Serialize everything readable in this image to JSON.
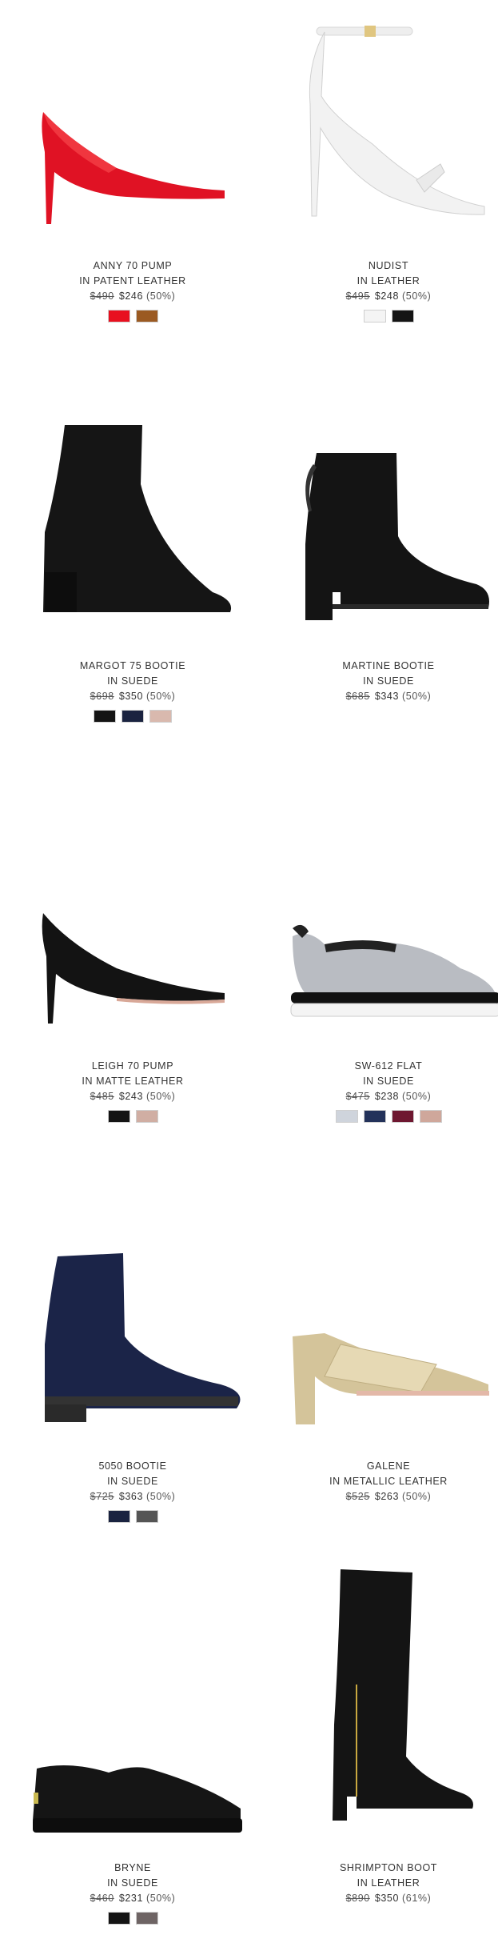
{
  "products": [
    {
      "name": "ANNY 70 PUMP",
      "material": "IN PATENT LEATHER",
      "orig": "$490",
      "sale": "$246",
      "disc": "(50%)",
      "swatches": [
        "#e8101f",
        "#9b5a22"
      ],
      "icon": "red-pump-shoe-icon"
    },
    {
      "name": "NUDIST",
      "material": "IN LEATHER",
      "orig": "$495",
      "sale": "$248",
      "disc": "(50%)",
      "swatches": [
        "#f4f4f4",
        "#141414"
      ],
      "icon": "white-strappy-sandal-icon"
    },
    {
      "name": "MARGOT 75 BOOTIE",
      "material": "IN SUEDE",
      "orig": "$698",
      "sale": "$350",
      "disc": "(50%)",
      "swatches": [
        "#141414",
        "#1a2340",
        "#d9b9ae"
      ],
      "icon": "black-sock-bootie-icon"
    },
    {
      "name": "MARTINE BOOTIE",
      "material": "IN SUEDE",
      "orig": "$685",
      "sale": "$343",
      "disc": "(50%)",
      "swatches": [],
      "icon": "black-ankle-bootie-icon"
    },
    {
      "name": "LEIGH 70 PUMP",
      "material": "IN MATTE LEATHER",
      "orig": "$485",
      "sale": "$243",
      "disc": "(50%)",
      "swatches": [
        "#141414",
        "#d0aea3"
      ],
      "icon": "black-pump-shoe-icon"
    },
    {
      "name": "SW-612 FLAT",
      "material": "IN SUEDE",
      "orig": "$475",
      "sale": "$238",
      "disc": "(50%)",
      "swatches": [
        "#cfd4dc",
        "#23325a",
        "#6e1730",
        "#cfa79b"
      ],
      "icon": "grey-sneaker-icon"
    },
    {
      "name": "5050 BOOTIE",
      "material": "IN SUEDE",
      "orig": "$725",
      "sale": "$363",
      "disc": "(50%)",
      "swatches": [
        "#1a2340",
        "#555555"
      ],
      "icon": "navy-ankle-boot-icon"
    },
    {
      "name": "GALENE",
      "material": "IN METALLIC LEATHER",
      "orig": "$525",
      "sale": "$263",
      "disc": "(50%)",
      "swatches": [],
      "icon": "gold-mule-icon"
    },
    {
      "name": "BRYNE",
      "material": "IN SUEDE",
      "orig": "$460",
      "sale": "$231",
      "disc": "(50%)",
      "swatches": [
        "#141414",
        "#6e6464"
      ],
      "icon": "black-slip-on-icon"
    },
    {
      "name": "SHRIMPTON BOOT",
      "material": "IN LEATHER",
      "orig": "$890",
      "sale": "$350",
      "disc": "(61%)",
      "swatches": [],
      "icon": "black-knee-boot-icon"
    }
  ]
}
